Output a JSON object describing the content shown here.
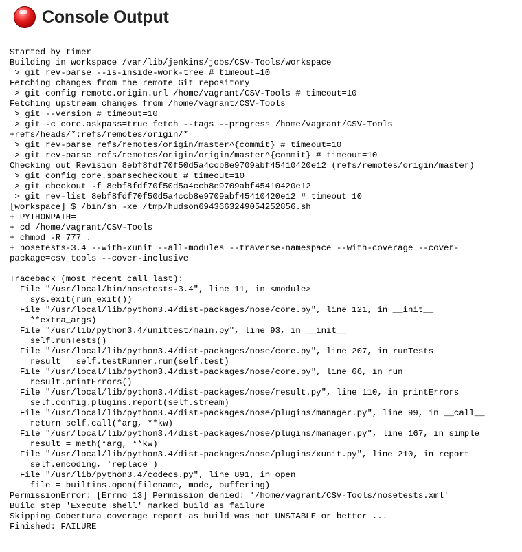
{
  "header": {
    "title": "Console Output",
    "status_icon": "red-ball-icon",
    "status_color": "#e21b1b"
  },
  "console": {
    "lines": [
      "Started by timer",
      "Building in workspace /var/lib/jenkins/jobs/CSV-Tools/workspace",
      " > git rev-parse --is-inside-work-tree # timeout=10",
      "Fetching changes from the remote Git repository",
      " > git config remote.origin.url /home/vagrant/CSV-Tools # timeout=10",
      "Fetching upstream changes from /home/vagrant/CSV-Tools",
      " > git --version # timeout=10",
      " > git -c core.askpass=true fetch --tags --progress /home/vagrant/CSV-Tools",
      "+refs/heads/*:refs/remotes/origin/*",
      " > git rev-parse refs/remotes/origin/master^{commit} # timeout=10",
      " > git rev-parse refs/remotes/origin/origin/master^{commit} # timeout=10",
      "Checking out Revision 8ebf8fdf70f50d5a4ccb8e9709abf45410420e12 (refs/remotes/origin/master)",
      " > git config core.sparsecheckout # timeout=10",
      " > git checkout -f 8ebf8fdf70f50d5a4ccb8e9709abf45410420e12",
      " > git rev-list 8ebf8fdf70f50d5a4ccb8e9709abf45410420e12 # timeout=10",
      "[workspace] $ /bin/sh -xe /tmp/hudson6943663249054252856.sh",
      "+ PYTHONPATH=",
      "+ cd /home/vagrant/CSV-Tools",
      "+ chmod -R 777 .",
      "+ nosetests-3.4 --with-xunit --all-modules --traverse-namespace --with-coverage --cover-",
      "package=csv_tools --cover-inclusive",
      "",
      "Traceback (most recent call last):",
      "  File \"/usr/local/bin/nosetests-3.4\", line 11, in <module>",
      "    sys.exit(run_exit())",
      "  File \"/usr/local/lib/python3.4/dist-packages/nose/core.py\", line 121, in __init__",
      "    **extra_args)",
      "  File \"/usr/lib/python3.4/unittest/main.py\", line 93, in __init__",
      "    self.runTests()",
      "  File \"/usr/local/lib/python3.4/dist-packages/nose/core.py\", line 207, in runTests",
      "    result = self.testRunner.run(self.test)",
      "  File \"/usr/local/lib/python3.4/dist-packages/nose/core.py\", line 66, in run",
      "    result.printErrors()",
      "  File \"/usr/local/lib/python3.4/dist-packages/nose/result.py\", line 110, in printErrors",
      "    self.config.plugins.report(self.stream)",
      "  File \"/usr/local/lib/python3.4/dist-packages/nose/plugins/manager.py\", line 99, in __call__",
      "    return self.call(*arg, **kw)",
      "  File \"/usr/local/lib/python3.4/dist-packages/nose/plugins/manager.py\", line 167, in simple",
      "    result = meth(*arg, **kw)",
      "  File \"/usr/local/lib/python3.4/dist-packages/nose/plugins/xunit.py\", line 210, in report",
      "    self.encoding, 'replace')",
      "  File \"/usr/lib/python3.4/codecs.py\", line 891, in open",
      "    file = builtins.open(filename, mode, buffering)",
      "PermissionError: [Errno 13] Permission denied: '/home/vagrant/CSV-Tools/nosetests.xml'",
      "Build step 'Execute shell' marked build as failure",
      "Skipping Cobertura coverage report as build was not UNSTABLE or better ...",
      "Finished: FAILURE"
    ]
  }
}
